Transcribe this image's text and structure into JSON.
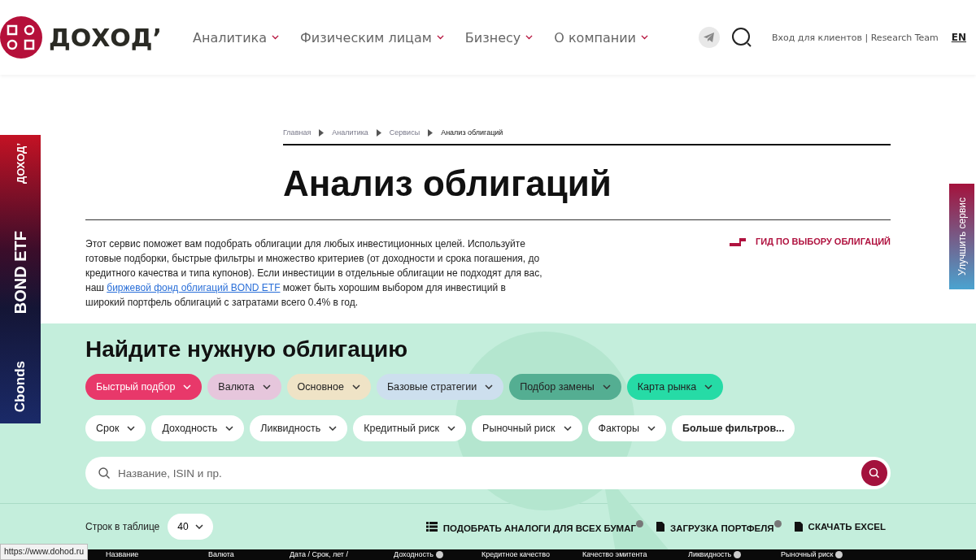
{
  "header": {
    "logo_text": "ДОХОД’",
    "nav": [
      {
        "label": "Аналитика"
      },
      {
        "label": "Физическим лицам"
      },
      {
        "label": "Бизнесу"
      },
      {
        "label": "О компании"
      }
    ],
    "login": "Вход для клиентов | Research Team",
    "language": "EN"
  },
  "side_banner": {
    "brand": "ДОХОД’",
    "product": "BOND ETF",
    "partner": "Cbonds"
  },
  "feedback_tab": "Улучшить сервис",
  "breadcrumbs": [
    {
      "label": "Главная",
      "current": false
    },
    {
      "label": "Аналитика",
      "current": false
    },
    {
      "label": "Сервисы",
      "current": false
    },
    {
      "label": "Анализ облигаций",
      "current": true
    }
  ],
  "title": "Анализ облигаций",
  "intro": {
    "before": "Этот сервис поможет вам подобрать облигации для любых инвестиционных целей. Используйте готовые подборки, быстрые фильтры и множество критериев (от доходности и срока погашения, до кредитного качества и типа купонов). Если инвестиции в отдельные облигации не подходят для вас, наш ",
    "link": "биржевой фонд облигаций BOND ETF",
    "after": " может быть хорошим выбором для инвестиций в широкий портфель облигаций с затратами всего 0.4% в год."
  },
  "guide_link": "ГИД ПО ВЫБОРУ ОБЛИГАЦИЙ",
  "finder": {
    "heading": "Найдите нужную облигацию",
    "presets": [
      {
        "label": "Быстрый подбор",
        "color": "#e8386a"
      },
      {
        "label": "Валюта",
        "color": "#e6c6dc"
      },
      {
        "label": "Основное",
        "color": "#efe3c6"
      },
      {
        "label": "Базовые стратегии",
        "color": "#cddfee"
      },
      {
        "label": "Подбор замены",
        "color": "#54ae92"
      },
      {
        "label": "Карта рынка",
        "color": "#26dba6"
      }
    ],
    "filters": [
      {
        "label": "Срок",
        "kind": "dropdown"
      },
      {
        "label": "Доходность",
        "kind": "dropdown"
      },
      {
        "label": "Ликвидность",
        "kind": "dropdown"
      },
      {
        "label": "Кредитный риск",
        "kind": "dropdown"
      },
      {
        "label": "Рыночный риск",
        "kind": "dropdown"
      },
      {
        "label": "Факторы",
        "kind": "dropdown"
      },
      {
        "label": "Больше фильтров...",
        "kind": "more"
      }
    ],
    "search": {
      "placeholder": "Название, ISIN и пр."
    },
    "rows_label": "Строк в таблице",
    "rows_value": "40",
    "actions": [
      {
        "label": "ПОДОБРАТЬ АНАЛОГИ ДЛЯ ВСЕХ БУМАГ",
        "kind": "list",
        "help": true
      },
      {
        "label": "ЗАГРУЗКА ПОРТФЕЛЯ",
        "kind": "file",
        "help": true
      },
      {
        "label": "СКАЧАТЬ EXCEL",
        "kind": "file",
        "help": false
      }
    ]
  },
  "table": {
    "columns": [
      {
        "label": "Название",
        "help": false
      },
      {
        "label": "Валюта",
        "help": false
      },
      {
        "label": "Дата / Срок, лет /",
        "help": false
      },
      {
        "label": "Доходность",
        "help": true
      },
      {
        "label": "Кредитное качество",
        "help": false
      },
      {
        "label": "Качество эмитента",
        "help": false
      },
      {
        "label": "Ликвидность",
        "help": true
      },
      {
        "label": "Рыночный риск",
        "help": true
      }
    ]
  },
  "status_url": "https://www.dohod.ru"
}
